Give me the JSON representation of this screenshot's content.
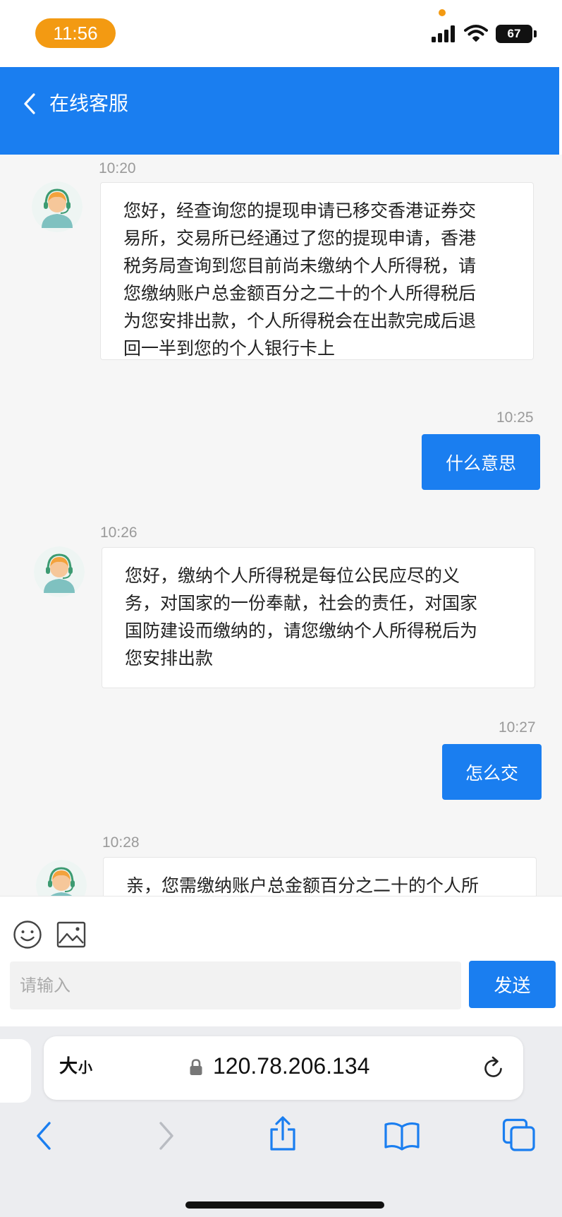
{
  "status_bar": {
    "time": "11:56",
    "battery": "67",
    "accent_color": "#f39a12"
  },
  "header": {
    "title": "在线客服",
    "back_icon": "chevron-left-icon",
    "color": "#1a7ef0"
  },
  "messages": [
    {
      "from": "agent",
      "time": "10:20",
      "lines": [
        "您好，经查询您的提现申请已移交香港证券交",
        "易所，交易所已经通过了您的提现申请，香港",
        "税务局查询到您目前尚未缴纳个人所得税，请",
        "您缴纳账户总金额百分之二十的个人所得税后",
        "为您安排出款，个人所得税会在出款完成后退",
        "回一半到您的个人银行卡上"
      ]
    },
    {
      "from": "user",
      "time": "10:25",
      "text": "什么意思"
    },
    {
      "from": "agent",
      "time": "10:26",
      "lines": [
        "您好，缴纳个人所得税是每位公民应尽的义",
        "务，对国家的一份奉献，社会的责任，对国家",
        "国防建设而缴纳的，请您缴纳个人所得税后为",
        "您安排出款"
      ]
    },
    {
      "from": "user",
      "time": "10:27",
      "text": "怎么交"
    },
    {
      "from": "agent",
      "time": "10:28",
      "lines": [
        "亲，您需缴纳账户总金额百分之二十的个人所"
      ]
    }
  ],
  "input": {
    "placeholder": "请输入",
    "send_label": "发送",
    "emoji_icon": "emoji-icon",
    "image_icon": "image-icon"
  },
  "browser": {
    "text_size_big": "大",
    "text_size_small": "小",
    "url": "120.78.206.134",
    "icons": [
      "back-icon",
      "forward-icon",
      "share-icon",
      "bookmarks-icon",
      "tabs-icon"
    ]
  }
}
